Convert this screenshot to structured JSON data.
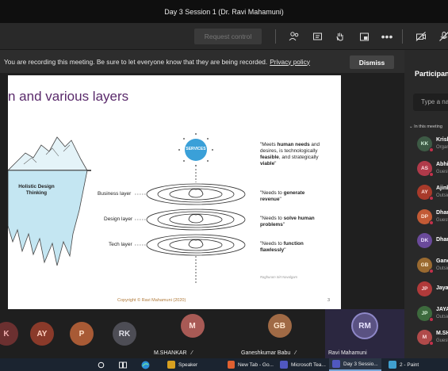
{
  "window": {
    "title": "Day 3 Session 1 (Dr. Ravi Mahamuni)"
  },
  "toolbar": {
    "request_control": "Request control"
  },
  "banner": {
    "message": "You are recording this meeting. Be sure to let everyone know that they are being recorded.",
    "link": "Privacy policy",
    "dismiss": "Dismiss"
  },
  "slide": {
    "title": "n and various layers",
    "iceberg_label": "Holistic Design Thinking",
    "services": "SERVICES",
    "layers": [
      "Business layer",
      "Design layer",
      "Tech layer"
    ],
    "quotes": [
      {
        "parts": [
          [
            "\"Meets ",
            false
          ],
          [
            "human needs",
            true
          ],
          [
            " and desires, is technologically ",
            false
          ],
          [
            "feasible",
            true
          ],
          [
            ", and strategically ",
            false
          ],
          [
            "viable",
            true
          ],
          [
            "\"",
            false
          ]
        ]
      },
      {
        "parts": [
          [
            "\"Needs to ",
            false
          ],
          [
            "generate revenue",
            true
          ],
          [
            "\"",
            false
          ]
        ]
      },
      {
        "parts": [
          [
            "\"Needs to ",
            false
          ],
          [
            "solve human problems",
            true
          ],
          [
            "\"",
            false
          ]
        ]
      },
      {
        "parts": [
          [
            "\"Needs to ",
            false
          ],
          [
            "function flawlessly",
            true
          ],
          [
            "\"",
            false
          ]
        ]
      }
    ],
    "credit": "Raghuram Sirt Navalgam",
    "footer": "Copyright © Ravi Mahamuni (2020)",
    "page": "3"
  },
  "people_bar": {
    "avatars": [
      {
        "initials": "K",
        "bg": "#6b3030",
        "fg": "#f0b0b0"
      },
      {
        "initials": "AY",
        "bg": "#8a3a2a",
        "fg": "#ffd0c0"
      },
      {
        "initials": "P",
        "bg": "#a85a35",
        "fg": "#ffe0c8"
      },
      {
        "initials": "RK",
        "bg": "#4d4d55",
        "fg": "#e0e0e8"
      }
    ],
    "tiles": [
      {
        "initials": "M",
        "name": "M.SHANKAR",
        "bg": "#a85a55",
        "fg": "#ffe0d8"
      },
      {
        "initials": "GB",
        "name": "Ganeshkumar Babu",
        "bg": "#a06a45",
        "fg": "#ffe6cc"
      },
      {
        "initials": "RM",
        "name": "Ravi Mahamuni",
        "bg": "#5a5282",
        "fg": "#e8e4ff"
      }
    ]
  },
  "panel": {
    "title": "Participants",
    "search_placeholder": "Type a name",
    "section": "In this meeting",
    "people": [
      {
        "initials": "KK",
        "name": "Krishna",
        "sub": "Organizer",
        "bg": "#3d5a45",
        "fg": "#d0f0d8"
      },
      {
        "initials": "AS",
        "name": "Abhishek",
        "sub": "Guest",
        "bg": "#b03a4a",
        "fg": "#ffe0e4"
      },
      {
        "initials": "AY",
        "name": "Ajinkya",
        "sub": "Outside",
        "bg": "#a83a2a",
        "fg": "#ffe0d8"
      },
      {
        "initials": "DP",
        "name": "Dhanashri",
        "sub": "Guest",
        "bg": "#c25a35",
        "fg": "#ffe4d4"
      },
      {
        "initials": "DK",
        "name": "Dhanesh",
        "sub": "",
        "bg": "#6a4a9a",
        "fg": "#ece0ff"
      },
      {
        "initials": "GB",
        "name": "Ganeshkumar",
        "sub": "Outside",
        "bg": "#9a6a30",
        "fg": "#fff0d8"
      },
      {
        "initials": "JP",
        "name": "Jayant",
        "sub": "",
        "bg": "#b03a3a",
        "fg": "#ffe0e0"
      },
      {
        "initials": "JP",
        "name": "JAYA",
        "sub": "Outside",
        "bg": "#3d6a3d",
        "fg": "#d8f4d8"
      },
      {
        "initials": "M",
        "name": "M.SHANKAR",
        "sub": "Guest",
        "bg": "#b04a4a",
        "fg": "#ffe0e0"
      }
    ]
  },
  "taskbar": {
    "items": [
      {
        "label": "Speaker",
        "color": "#d8a020",
        "active": false
      },
      {
        "label": "New Tab - Go...",
        "color": "#e06030",
        "active": false
      },
      {
        "label": "Microsoft Tea...",
        "color": "#5058c0",
        "active": false
      },
      {
        "label": "Day 3 Sessio...",
        "color": "#5058c0",
        "active": true
      },
      {
        "label": "2 - Paint",
        "color": "#40a0d0",
        "active": false
      }
    ]
  }
}
